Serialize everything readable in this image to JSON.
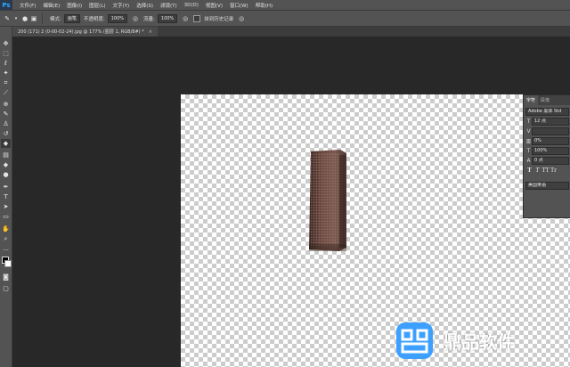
{
  "menubar": {
    "app_logo": "Ps",
    "items": [
      "文件(F)",
      "编辑(E)",
      "图像(I)",
      "图层(L)",
      "文字(Y)",
      "选择(S)",
      "滤镜(T)",
      "3D(D)",
      "视图(V)",
      "窗口(W)",
      "帮助(H)"
    ]
  },
  "options": {
    "mode_label": "模式:",
    "mode_value": "画笔",
    "opacity_label": "不透明度:",
    "opacity_value": "100%",
    "flow_label": "流量:",
    "flow_value": "100%",
    "erase_history_label": "抹到历史记录"
  },
  "document": {
    "tab_title": "200 (171) 2 (0-00-02-24).jpg @ 177% (图层 1, RGB/8#) *",
    "close_symbol": "×"
  },
  "panel": {
    "tabs": [
      "字符",
      "段落"
    ],
    "font_family": "Adobe 黑体 Std",
    "font_size": "12 点",
    "tracking": "0%",
    "scale": "100%",
    "baseline": "0 点",
    "language": "美国英语",
    "format_buttons": [
      "T",
      "T",
      "TT",
      "Tr"
    ]
  },
  "watermark": {
    "text": "鼎品软件"
  },
  "colors": {
    "ui_bg": "#535353",
    "workspace": "#282828",
    "accent": "#31a8ff",
    "building": "#6b4a40"
  },
  "icons": [
    "eraser-icon",
    "move-icon",
    "marquee-icon",
    "lasso-icon",
    "magic-wand-icon",
    "crop-icon",
    "eyedropper-icon",
    "healing-icon",
    "brush-icon",
    "clone-stamp-icon",
    "history-brush-icon",
    "eraser-tool-icon",
    "gradient-icon",
    "blur-icon",
    "dodge-icon",
    "pen-icon",
    "type-icon",
    "path-selection-icon",
    "shape-icon",
    "hand-icon",
    "zoom-icon"
  ]
}
